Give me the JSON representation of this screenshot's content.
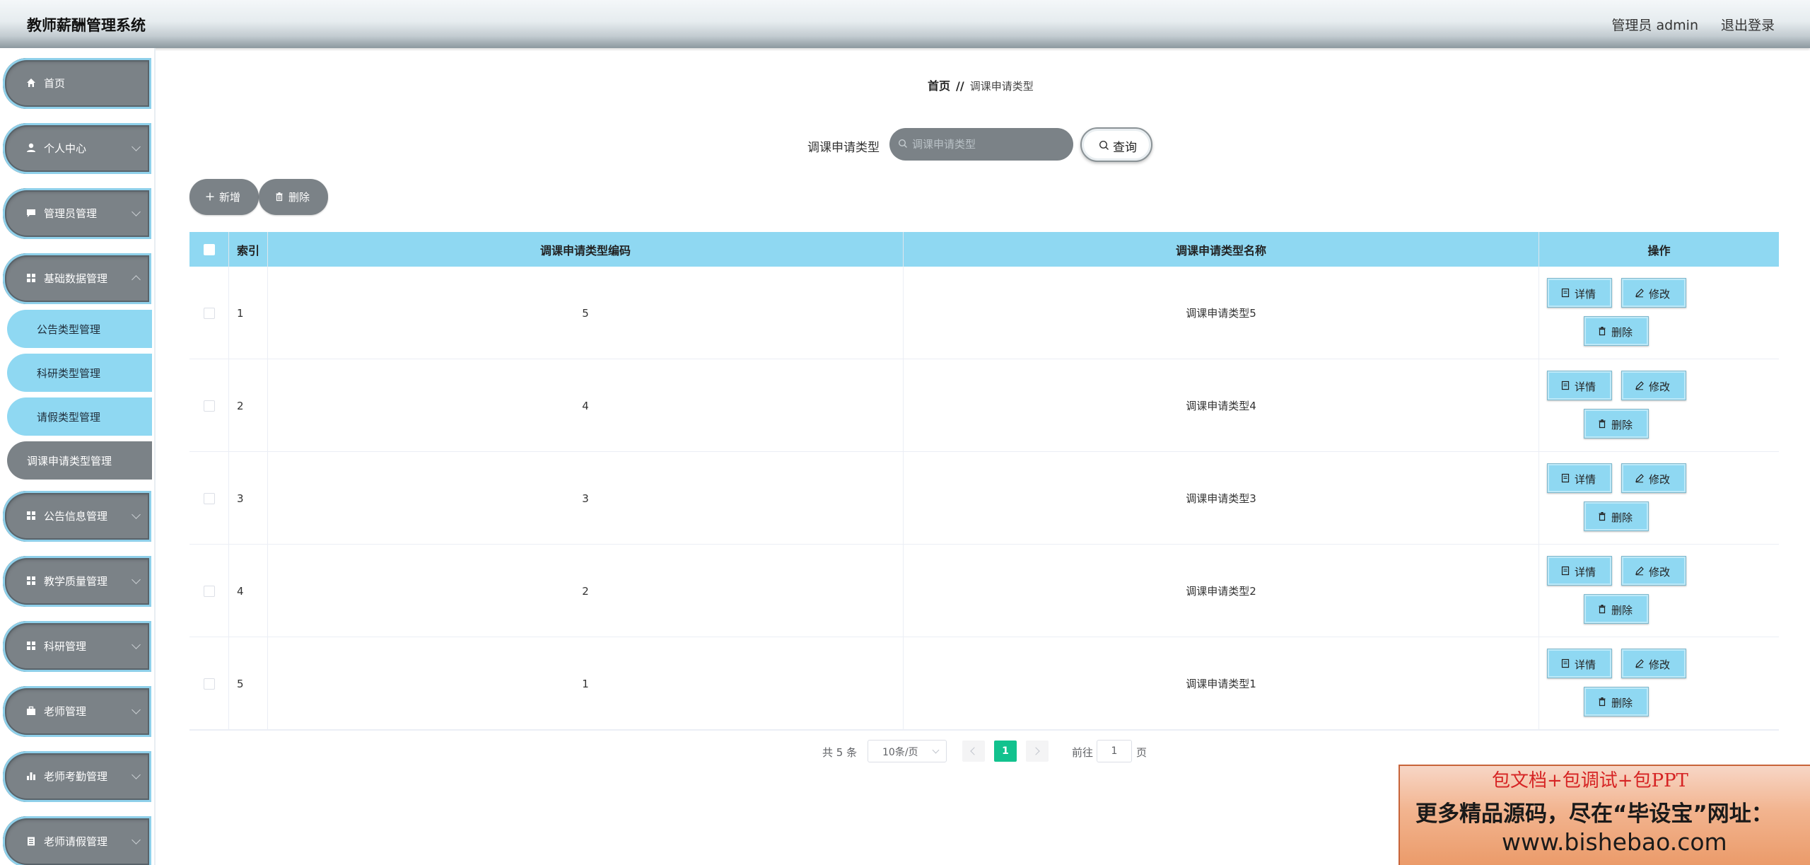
{
  "header": {
    "app_title": "教师薪酬管理系统",
    "user": "管理员 admin",
    "logout": "退出登录"
  },
  "sidebar": {
    "items": [
      {
        "label": "首页",
        "icon": "home-icon",
        "has_arrow": false
      },
      {
        "label": "个人中心",
        "icon": "user-icon",
        "has_arrow": true
      },
      {
        "label": "管理员管理",
        "icon": "chat-icon",
        "has_arrow": true
      },
      {
        "label": "基础数据管理",
        "icon": "grid-icon",
        "has_arrow": true,
        "expanded": true
      },
      {
        "label": "公告信息管理",
        "icon": "grid-icon",
        "has_arrow": true
      },
      {
        "label": "教学质量管理",
        "icon": "grid-icon",
        "has_arrow": true
      },
      {
        "label": "科研管理",
        "icon": "grid-icon",
        "has_arrow": true
      },
      {
        "label": "老师管理",
        "icon": "briefcase-icon",
        "has_arrow": true
      },
      {
        "label": "老师考勤管理",
        "icon": "bar-chart-icon",
        "has_arrow": true
      },
      {
        "label": "老师请假管理",
        "icon": "clipboard-icon",
        "has_arrow": true
      }
    ],
    "subitems": [
      {
        "label": "公告类型管理",
        "active": false
      },
      {
        "label": "科研类型管理",
        "active": false
      },
      {
        "label": "请假类型管理",
        "active": false
      },
      {
        "label": "调课申请类型管理",
        "active": true
      }
    ]
  },
  "breadcrumb": {
    "home": "首页",
    "separator": "//",
    "current": "调课申请类型"
  },
  "search": {
    "label": "调课申请类型",
    "placeholder": "调课申请类型",
    "value": "",
    "query_button": "查询"
  },
  "actions": {
    "add": "新增",
    "delete": "删除"
  },
  "table": {
    "headers": {
      "index": "索引",
      "code": "调课申请类型编码",
      "name": "调课申请类型名称",
      "ops": "操作"
    },
    "rows": [
      {
        "index": "1",
        "code": "5",
        "name": "调课申请类型5"
      },
      {
        "index": "2",
        "code": "4",
        "name": "调课申请类型4"
      },
      {
        "index": "3",
        "code": "3",
        "name": "调课申请类型3"
      },
      {
        "index": "4",
        "code": "2",
        "name": "调课申请类型2"
      },
      {
        "index": "5",
        "code": "1",
        "name": "调课申请类型1"
      }
    ],
    "row_ops": {
      "detail": "详情",
      "edit": "修改",
      "delete": "删除"
    }
  },
  "pagination": {
    "total": "共 5 条",
    "page_size": "10条/页",
    "current_page": "1",
    "goto_label": "前往",
    "goto_value": "1",
    "page_unit": "页"
  },
  "ad": {
    "line1": "包文档+包调试+包PPT",
    "line2": "更多精品源码，尽在“毕设宝”网址：",
    "line3": "www.bishebao.com"
  },
  "colors": {
    "accent_blue": "#8fd8f2",
    "menu_gray": "#7b8287",
    "page_active": "#12c28e"
  }
}
